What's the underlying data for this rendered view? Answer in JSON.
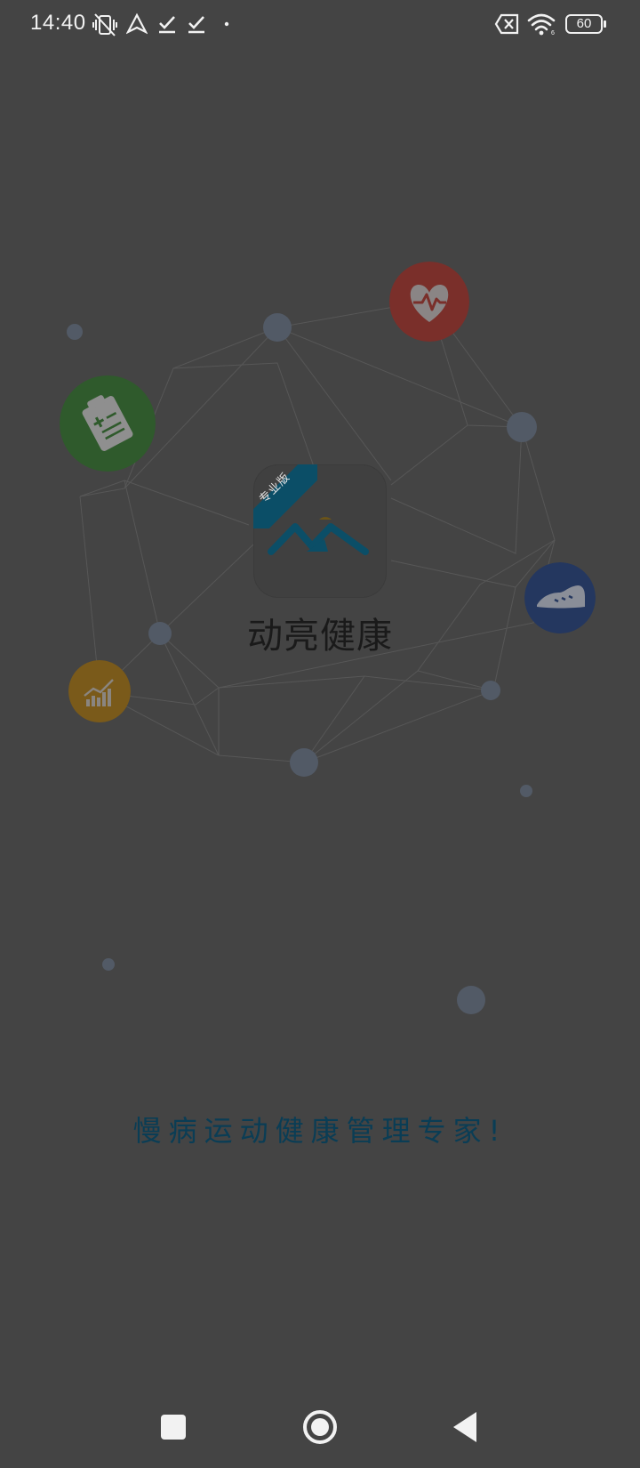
{
  "status_bar": {
    "time": "14:40",
    "battery_level": "60",
    "icons_left": [
      "vibrate-off-icon",
      "navigation-icon",
      "download-done-icon",
      "download-done-icon",
      "dot-icon"
    ],
    "icons_right": [
      "sim-off-icon",
      "wifi-icon",
      "battery-icon"
    ]
  },
  "splash": {
    "app_logo": {
      "ribbon_label": "专业版",
      "accent_color": "#0b4e67"
    },
    "app_name": "动亮健康",
    "slogan": "慢病运动健康管理专家!",
    "features": [
      {
        "name": "heart-rate",
        "icon": "heart-pulse-icon",
        "color": "#7a2f2a"
      },
      {
        "name": "medical-record",
        "icon": "clipboard-icon",
        "color": "#2f5a2c"
      },
      {
        "name": "exercise",
        "icon": "shoe-icon",
        "color": "#24375f"
      },
      {
        "name": "statistics",
        "icon": "chart-icon",
        "color": "#7a5a1a"
      }
    ],
    "background_color": "#444444"
  },
  "nav_bar": {
    "buttons": [
      "recents-button",
      "home-button",
      "back-button"
    ]
  }
}
